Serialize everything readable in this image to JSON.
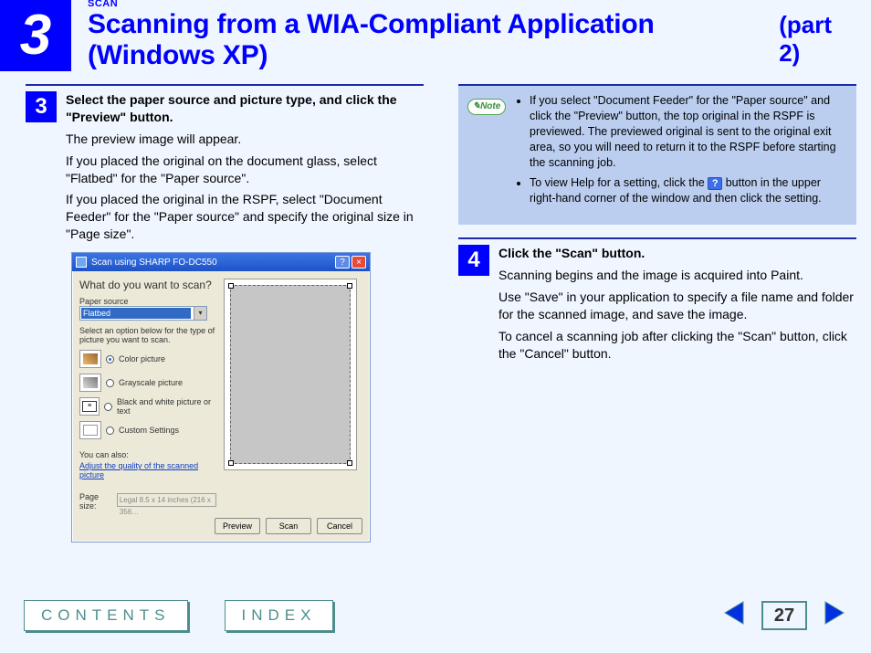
{
  "header": {
    "chapter_number": "3",
    "section_label": "SCAN",
    "title": "Scanning from a WIA-Compliant Application (Windows XP)",
    "part": "(part 2)"
  },
  "step3": {
    "number": "3",
    "lead": "Select the paper source and picture type, and click the \"Preview\" button.",
    "p1": "The preview image will appear.",
    "p2": "If you placed the original on the document glass, select \"Flatbed\" for the \"Paper source\".",
    "p3": "If you placed the original in the RSPF, select \"Document Feeder\" for the \"Paper source\" and specify the original size in \"Page size\"."
  },
  "note": {
    "badge": "Note",
    "item1": "If you select \"Document Feeder\" for the \"Paper source\" and click the \"Preview\" button, the top original in the RSPF is previewed. The previewed original is sent to the original exit area, so you will need to return it to the RSPF before starting the scanning job.",
    "item2a": "To view Help for a setting, click the ",
    "help_glyph": "?",
    "item2b": " button in the upper right-hand corner of the window and then click the setting."
  },
  "step4": {
    "number": "4",
    "lead": "Click the \"Scan\" button.",
    "p1": "Scanning begins and the image is acquired into Paint.",
    "p2": "Use \"Save\" in your application to specify a file name and folder for the scanned image, and save the image.",
    "p3": "To cancel a scanning job after clicking the \"Scan\" button, click the \"Cancel\" button."
  },
  "dialog": {
    "title": "Scan using SHARP FO-DC550",
    "heading": "What do you want to scan?",
    "paper_source_label": "Paper source",
    "paper_source_value": "Flatbed",
    "option_prompt": "Select an option below for the type of picture you want to scan.",
    "opt_color": "Color picture",
    "opt_gray": "Grayscale picture",
    "opt_bw": "Black and white picture or text",
    "opt_custom": "Custom Settings",
    "also_label": "You can also:",
    "adjust_link": "Adjust the quality of the scanned picture",
    "page_size_label": "Page size:",
    "page_size_value": "Legal 8.5 x 14 inches (216 x 356…",
    "btn_preview": "Preview",
    "btn_scan": "Scan",
    "btn_cancel": "Cancel"
  },
  "nav": {
    "contents": "CONTENTS",
    "index": "INDEX",
    "page_number": "27"
  }
}
